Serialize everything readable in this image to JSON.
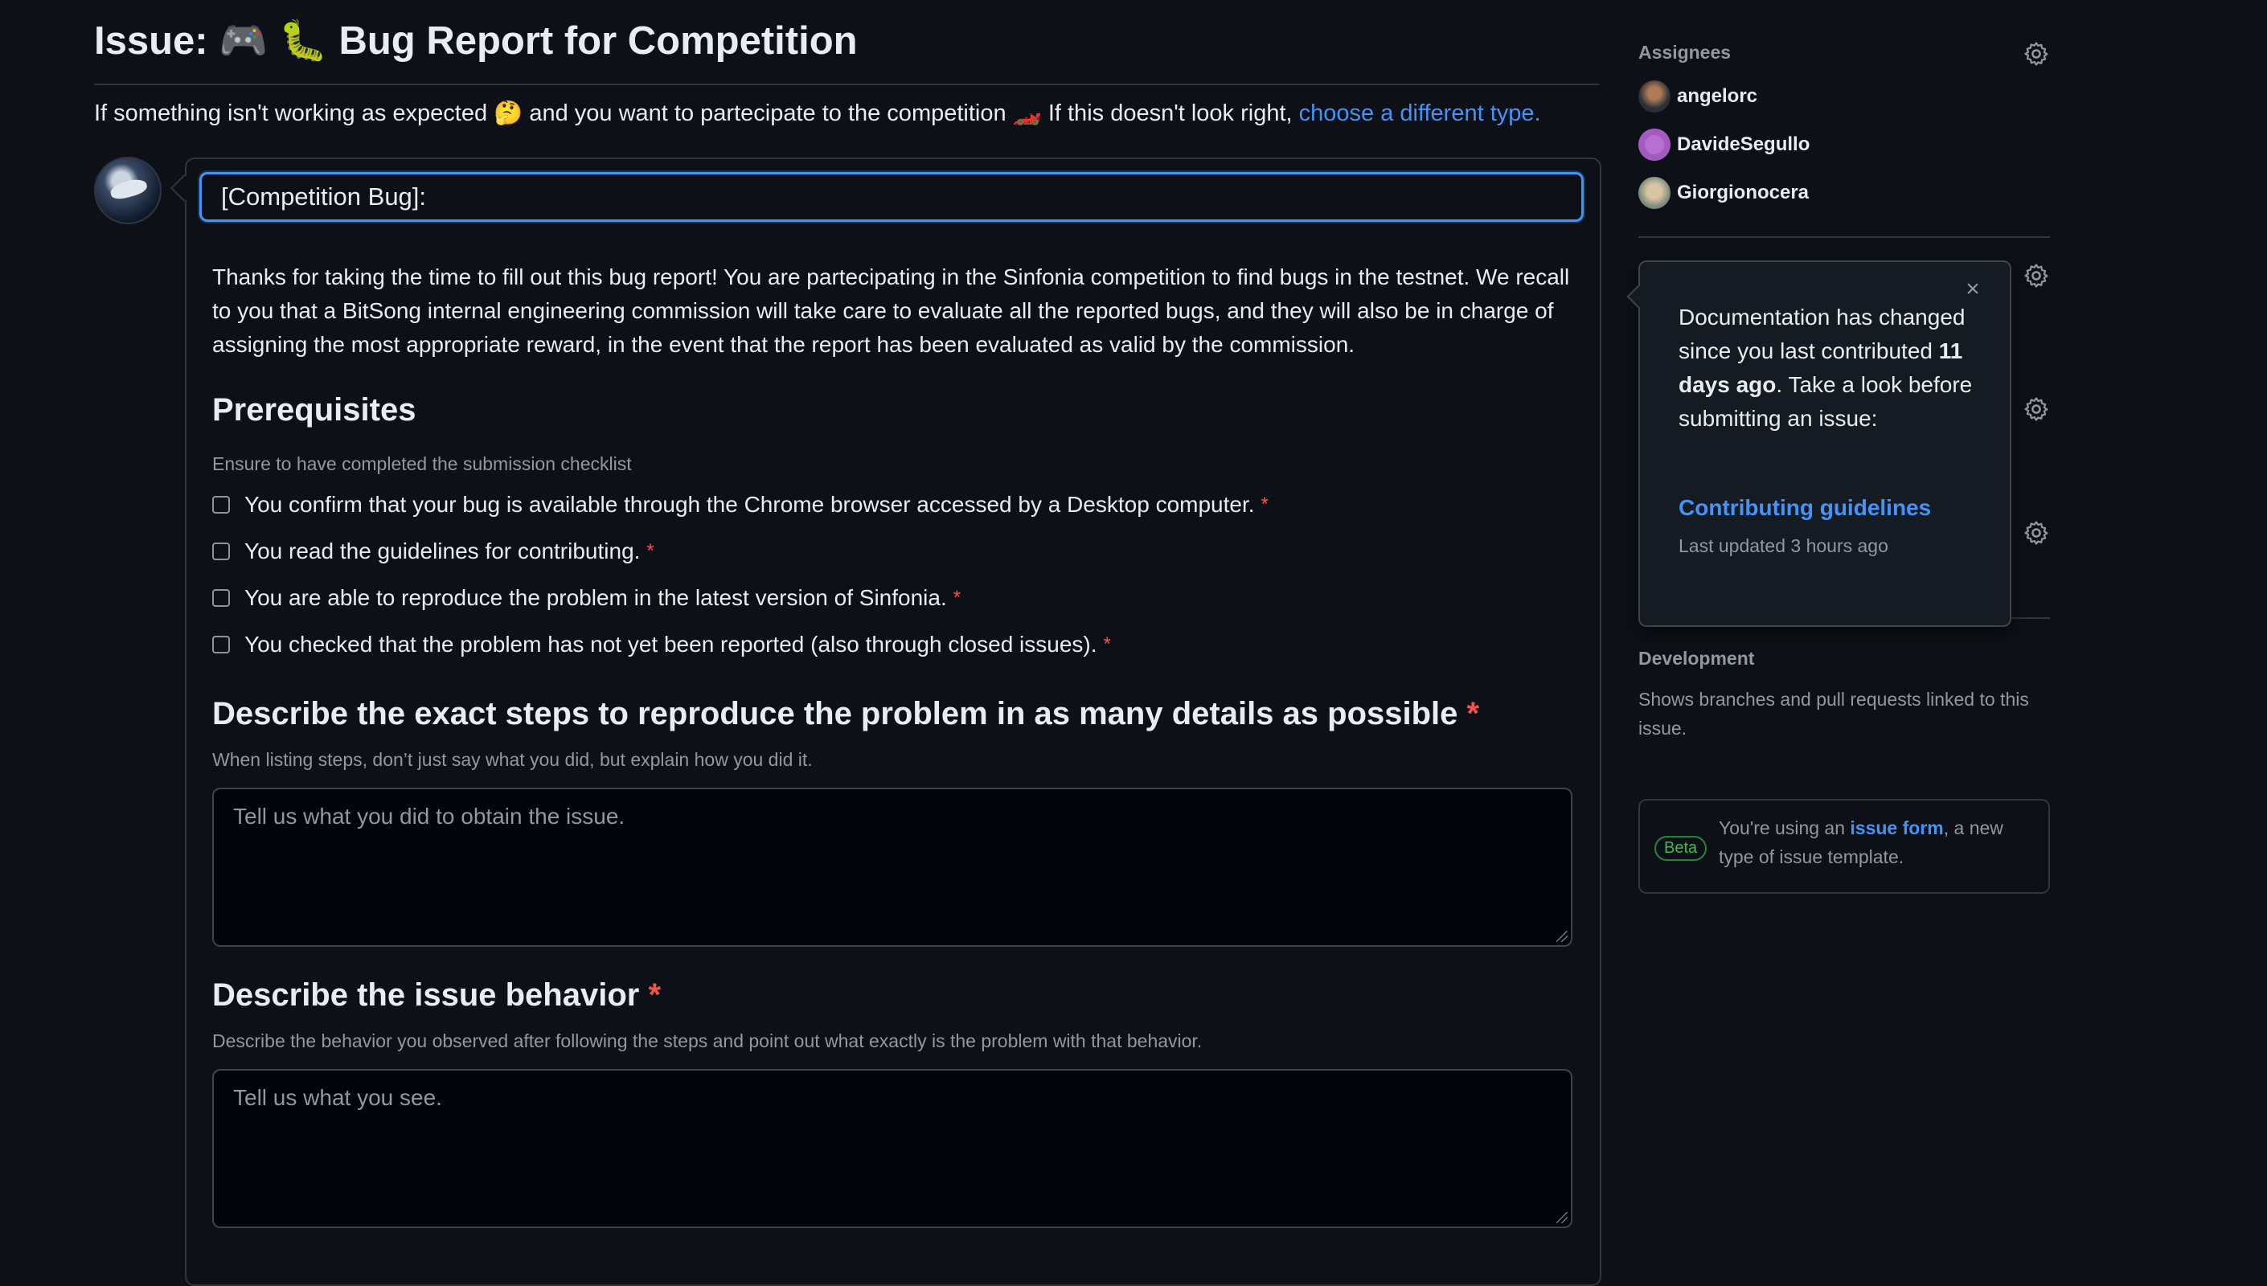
{
  "page": {
    "title": "Issue: 🎮 🐛 Bug Report for Competition",
    "subtitle_text": "If something isn't working as expected 🤔 and you want to partecipate to the competition 🏎️ If this doesn't look right, ",
    "subtitle_link": "choose a different type."
  },
  "form": {
    "title_value": "[Competition Bug]: ",
    "intro": "Thanks for taking the time to fill out this bug report! You are partecipating in the Sinfonia competition to find bugs in the testnet. We recall to you that a BitSong internal engineering commission will take care to evaluate all the reported bugs, and they will also be in charge of assigning the most appropriate reward, in the event that the report has been evaluated as valid by the commission.",
    "prereq_heading": "Prerequisites",
    "prereq_desc": "Ensure to have completed the submission checklist",
    "checks": [
      {
        "label": "You confirm that your bug is available through the Chrome browser accessed by a Desktop computer.",
        "required": "*"
      },
      {
        "label": "You read the guidelines for contributing.",
        "required": "*"
      },
      {
        "label": "You are able to reproduce the problem in the latest version of Sinfonia.",
        "required": "*"
      },
      {
        "label": "You checked that the problem has not yet been reported (also through closed issues).",
        "required": "*"
      }
    ],
    "steps_heading": "Describe the exact steps to reproduce the problem in as many details as possible",
    "steps_required": "*",
    "steps_desc": "When listing steps, don’t just say what you did, but explain how you did it.",
    "steps_placeholder": "Tell us what you did to obtain the issue.",
    "behavior_heading": "Describe the issue behavior",
    "behavior_required": "*",
    "behavior_desc": "Describe the behavior you observed after following the steps and point out what exactly is the problem with that behavior.",
    "behavior_placeholder": "Tell us what you see."
  },
  "sidebar": {
    "assignees_label": "Assignees",
    "assignees": [
      "angelorc",
      "DavideSegullo",
      "Giorgionocera"
    ],
    "development_label": "Development",
    "development_text": "Shows branches and pull requests linked to this issue.",
    "beta_badge": "Beta",
    "beta_text_pre": "You're using an ",
    "beta_link": "issue form",
    "beta_text_post": ", a new type of issue template."
  },
  "popover": {
    "text_pre": "Documentation has changed since you last contributed ",
    "text_bold": "11 days ago",
    "text_post": ". Take a look before submitting an issue:",
    "link": "Contributing guidelines",
    "updated": "Last updated 3 hours ago",
    "close_glyph": "×"
  },
  "colors": {
    "background": "#0d1117",
    "accent": "#4493f8",
    "required": "#f85149",
    "beta": "#3fb950"
  },
  "icons": {
    "gear": "gear-icon",
    "close": "close-icon"
  }
}
